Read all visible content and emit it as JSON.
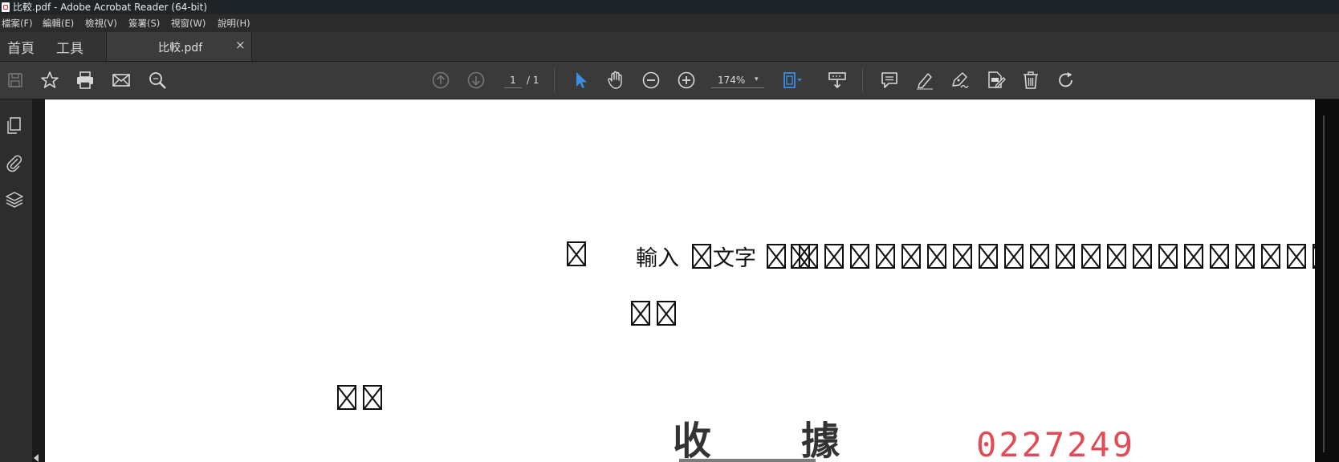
{
  "window": {
    "title": "比較.pdf - Adobe Acrobat Reader (64-bit)",
    "icon": "pdf-app-icon"
  },
  "menu": [
    {
      "label": "檔案(F)"
    },
    {
      "label": "編輯(E)"
    },
    {
      "label": "檢視(V)"
    },
    {
      "label": "簽署(S)"
    },
    {
      "label": "視窗(W)"
    },
    {
      "label": "說明(H)"
    }
  ],
  "tabs": {
    "home": "首頁",
    "tools": "工具",
    "document": "比較.pdf",
    "close": "×"
  },
  "toolbar": {
    "page_current": "1",
    "page_total": "/ 1",
    "zoom": "174%",
    "zoom_caret": "▾",
    "accent": "#3b8ee6"
  },
  "document": {
    "line1_text_a": "輸入",
    "line1_text_b": "文字",
    "receipt_left": "收",
    "receipt_right": "據",
    "serial": "0227249",
    "serial_color": "#e24b55"
  }
}
